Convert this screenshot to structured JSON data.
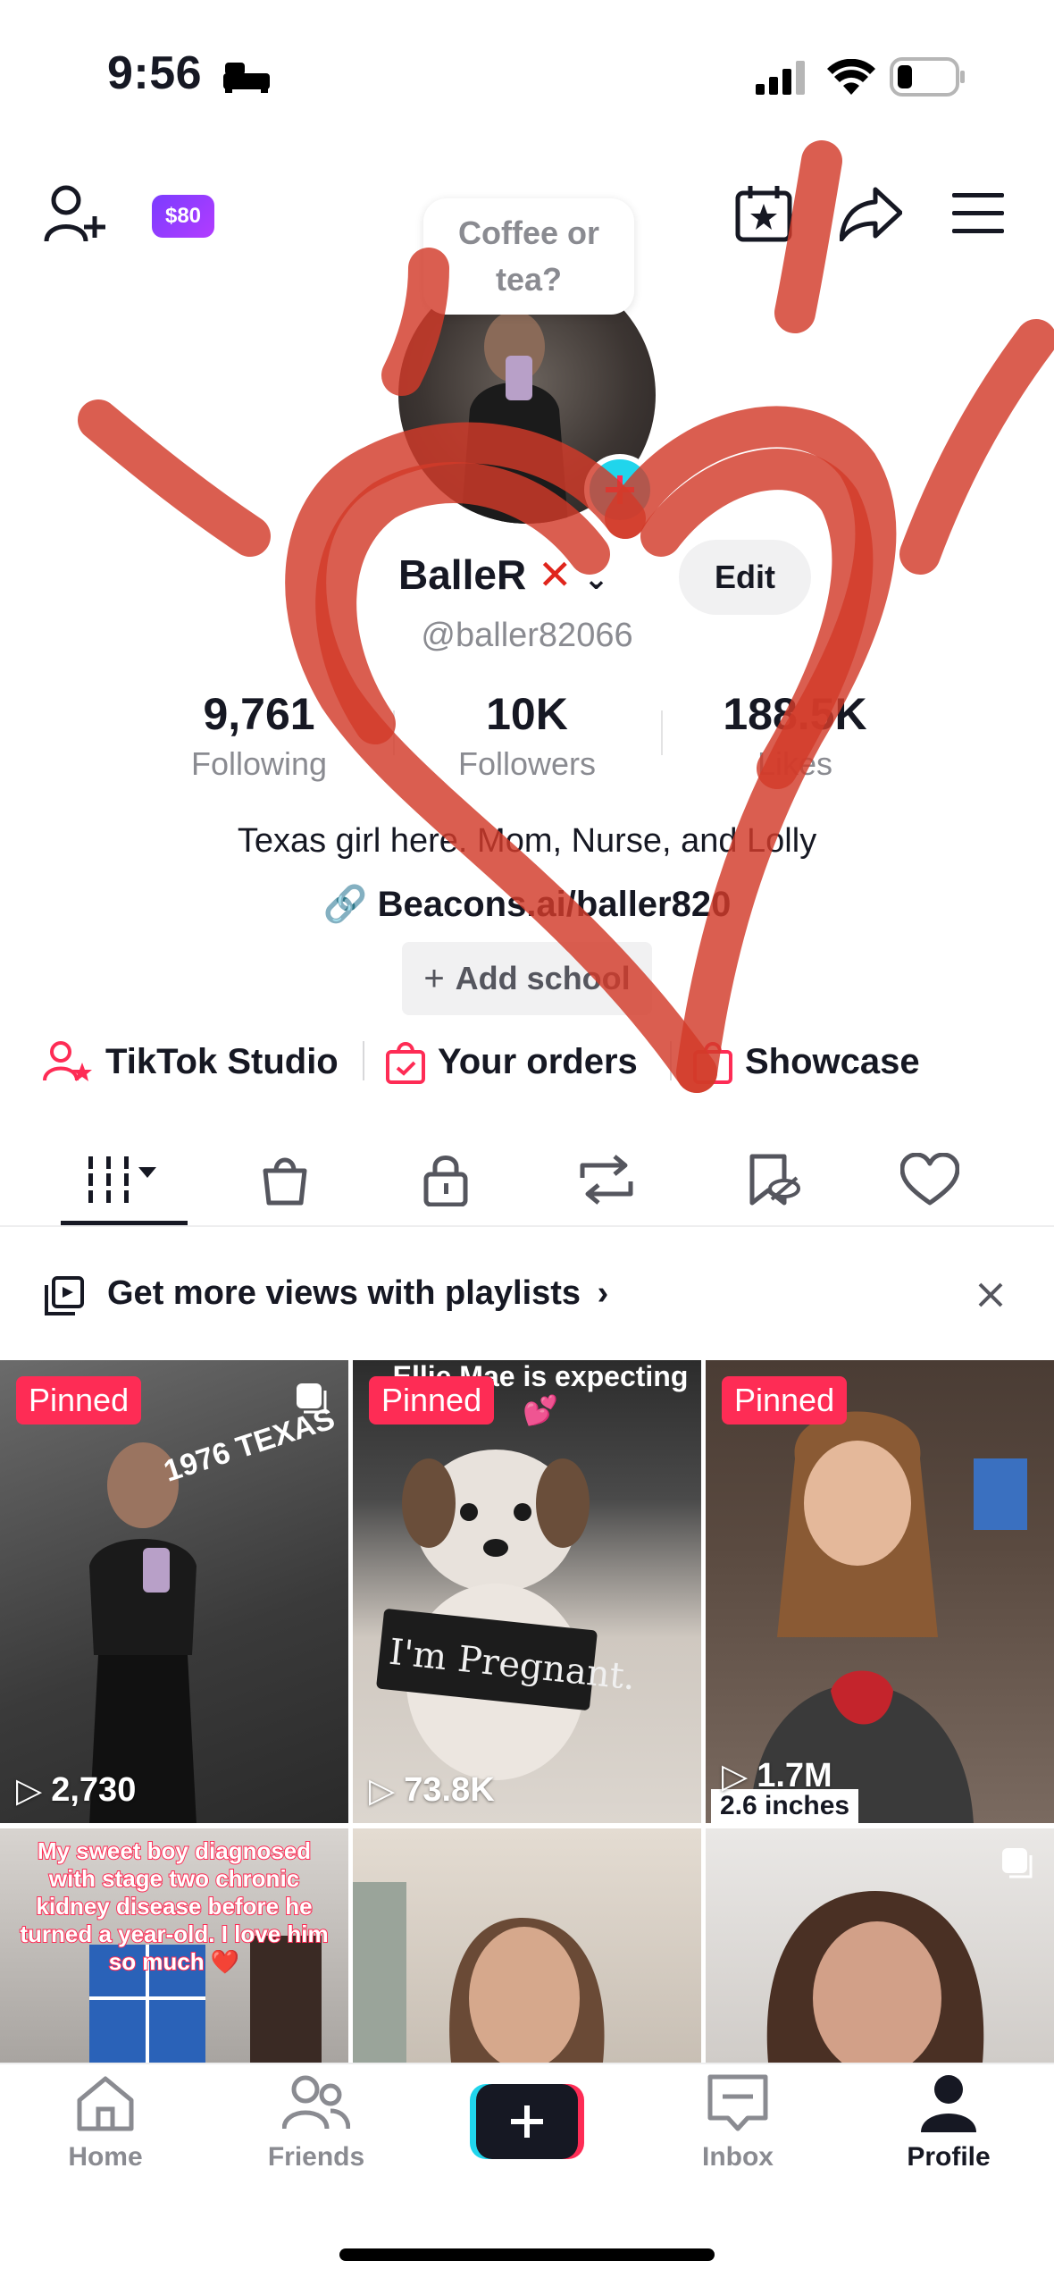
{
  "status_bar": {
    "time": "9:56"
  },
  "top_bar": {
    "badge": "$80"
  },
  "profile": {
    "bubble_text": "Coffee or tea?",
    "display_name": "BalleR",
    "edit_label": "Edit",
    "handle": "@baller82066",
    "stats": [
      {
        "value": "9,761",
        "label": "Following"
      },
      {
        "value": "10K",
        "label": "Followers"
      },
      {
        "value": "188.5K",
        "label": "Likes"
      }
    ],
    "bio": "Texas girl here. Mom, Nurse, and Lolly",
    "link": "Beacons.ai/baller820",
    "add_school": "Add school"
  },
  "quick_links": [
    {
      "label": "TikTok Studio"
    },
    {
      "label": "Your orders"
    },
    {
      "label": "Showcase"
    }
  ],
  "playlist_banner": {
    "text": "Get more views with playlists"
  },
  "grid": [
    {
      "pinned": "Pinned",
      "views": "2,730",
      "overlay": "1976 TEXAS"
    },
    {
      "pinned": "Pinned",
      "views": "73.8K",
      "overlay_top": "Ellie Mae is expecting 💕",
      "sign": "I'm Pregnant."
    },
    {
      "pinned": "Pinned",
      "views": "1.7M",
      "overlay": "2.6 inches"
    },
    {
      "caption": "My sweet boy diagnosed with stage two chronic kidney disease before he turned a year-old. I love him so much ❤️"
    },
    {},
    {}
  ],
  "bottom_nav": [
    {
      "label": "Home"
    },
    {
      "label": "Friends"
    },
    {
      "label": "Inbox"
    },
    {
      "label": "Profile"
    }
  ],
  "colors": {
    "accent": "#fe2c55",
    "teal": "#20d5ec",
    "scribble": "#d23a2a"
  }
}
